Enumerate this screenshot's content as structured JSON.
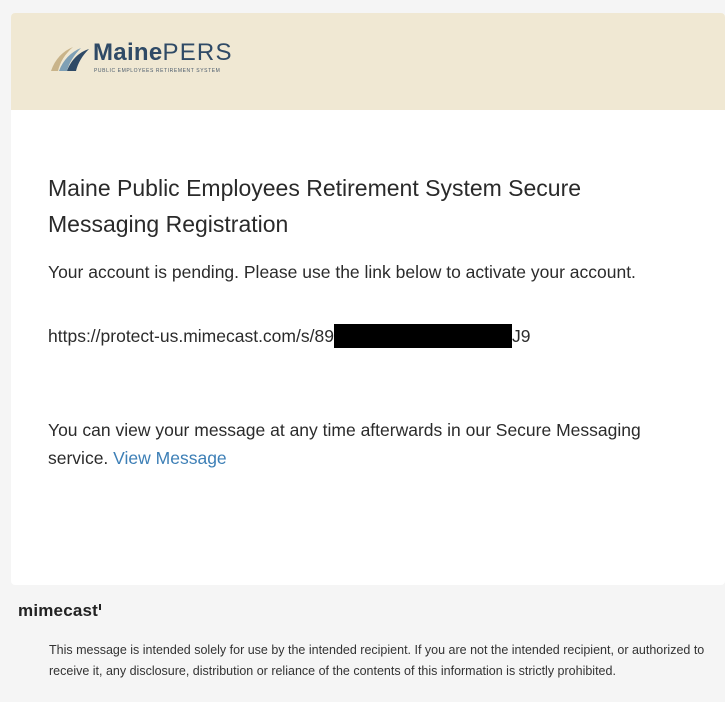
{
  "header": {
    "logo_word_1": "Maine",
    "logo_word_2": "PERS",
    "logo_tagline": "PUBLIC EMPLOYEES RETIREMENT SYSTEM"
  },
  "message": {
    "title": "Maine Public Employees Retirement System Secure Messaging Registration",
    "pending_text": "Your account is pending. Please use the link below to activate your account.",
    "link_prefix": "https://protect-us.mimecast.com/s/89",
    "link_suffix": "J9",
    "view_text": "You can view your message at any time afterwards in our Secure Messaging service.",
    "view_link_label": "View Message"
  },
  "footer": {
    "brand": "mimecast",
    "disclaimer": "This message is intended solely for use by the intended recipient. If you are not the intended recipient, or authorized to receive it, any disclosure, distribution or reliance of the contents of this information is strictly prohibited."
  },
  "colors": {
    "banner": "#f0e8d3",
    "logo_navy": "#2f4a66",
    "logo_sand": "#c9b48a",
    "logo_teal": "#7fa0b5",
    "link": "#3d7fb6",
    "redaction": "#000000"
  }
}
